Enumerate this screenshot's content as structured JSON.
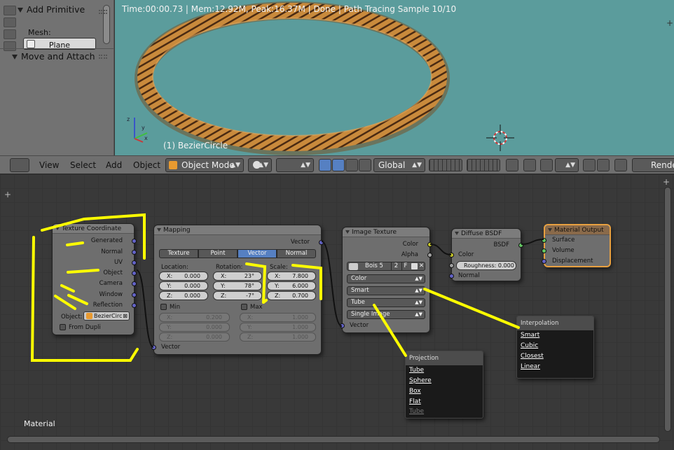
{
  "tool_panel": {
    "add_primitive": "Add Primitive",
    "mesh_label": "Mesh:",
    "plane_button": "Plane",
    "move_attach": "Move and Attach"
  },
  "viewport": {
    "status": "Time:00:00.73 | Mem:12.92M, Peak:16.37M | Done | Path Tracing Sample 10/10",
    "object_name": "(1) BezierCircle",
    "axis_x": "x",
    "axis_y": "y",
    "axis_z": "z"
  },
  "header": {
    "menus": [
      "View",
      "Select",
      "Add",
      "Object"
    ],
    "mode": "Object Mode",
    "orientation": "Global",
    "render": "Render"
  },
  "nodes": {
    "tex_coord": {
      "title": "Texture Coordinate",
      "outputs": [
        "Generated",
        "Normal",
        "UV",
        "Object",
        "Camera",
        "Window",
        "Reflection"
      ],
      "object_label": "Object:",
      "object_value": "BezierCirc",
      "from_dupli": "From Dupli"
    },
    "mapping": {
      "title": "Mapping",
      "output": "Vector",
      "tabs": [
        "Texture",
        "Point",
        "Vector",
        "Normal"
      ],
      "location_label": "Location:",
      "rotation_label": "Rotation:",
      "scale_label": "Scale:",
      "location": [
        {
          "a": "X:",
          "v": "0.000"
        },
        {
          "a": "Y:",
          "v": "0.000"
        },
        {
          "a": "Z:",
          "v": "0.000"
        }
      ],
      "rotation": [
        {
          "a": "X:",
          "v": "23°"
        },
        {
          "a": "Y:",
          "v": "78°"
        },
        {
          "a": "Z:",
          "v": "-7°"
        }
      ],
      "scale": [
        {
          "a": "X:",
          "v": "7.800"
        },
        {
          "a": "Y:",
          "v": "6.000"
        },
        {
          "a": "Z:",
          "v": "0.700"
        }
      ],
      "min_label": "Min",
      "max_label": "Max",
      "min": [
        {
          "a": "X:",
          "v": "0.200"
        },
        {
          "a": "Y:",
          "v": "0.000"
        },
        {
          "a": "Z:",
          "v": "0.000"
        }
      ],
      "max": [
        {
          "a": "X:",
          "v": "1.000"
        },
        {
          "a": "Y:",
          "v": "1.000"
        },
        {
          "a": "Z:",
          "v": "1.000"
        }
      ],
      "input": "Vector"
    },
    "image_texture": {
      "title": "Image Texture",
      "out_color": "Color",
      "out_alpha": "Alpha",
      "image_name": "Bois 5",
      "users": "2",
      "fake": "F",
      "color_space": "Color",
      "interpolation": "Smart",
      "projection": "Tube",
      "extension": "Single Image",
      "input": "Vector"
    },
    "diffuse": {
      "title": "Diffuse BSDF",
      "output": "BSDF",
      "in_color": "Color",
      "roughness": "Roughness: 0.000",
      "in_normal": "Normal"
    },
    "output": {
      "title": "Material Output",
      "inputs": [
        "Surface",
        "Volume",
        "Displacement"
      ]
    }
  },
  "popups": {
    "interpolation": {
      "title": "Interpolation",
      "items": [
        "Smart",
        "Cubic",
        "Closest",
        "Linear"
      ]
    },
    "projection": {
      "title": "Projection",
      "items": [
        "Tube",
        "Sphere",
        "Box",
        "Flat"
      ],
      "cut_item": "Tube"
    }
  },
  "editor_label": "Material",
  "colors": {
    "viewport_bg": "#5b9c9c",
    "vector_socket": "#6363c7",
    "color_socket": "#c7c729",
    "shader_socket": "#63c763",
    "active_tab": "#5680c2",
    "annotation": "#ffff00",
    "output_node_border": "#e8a040"
  }
}
